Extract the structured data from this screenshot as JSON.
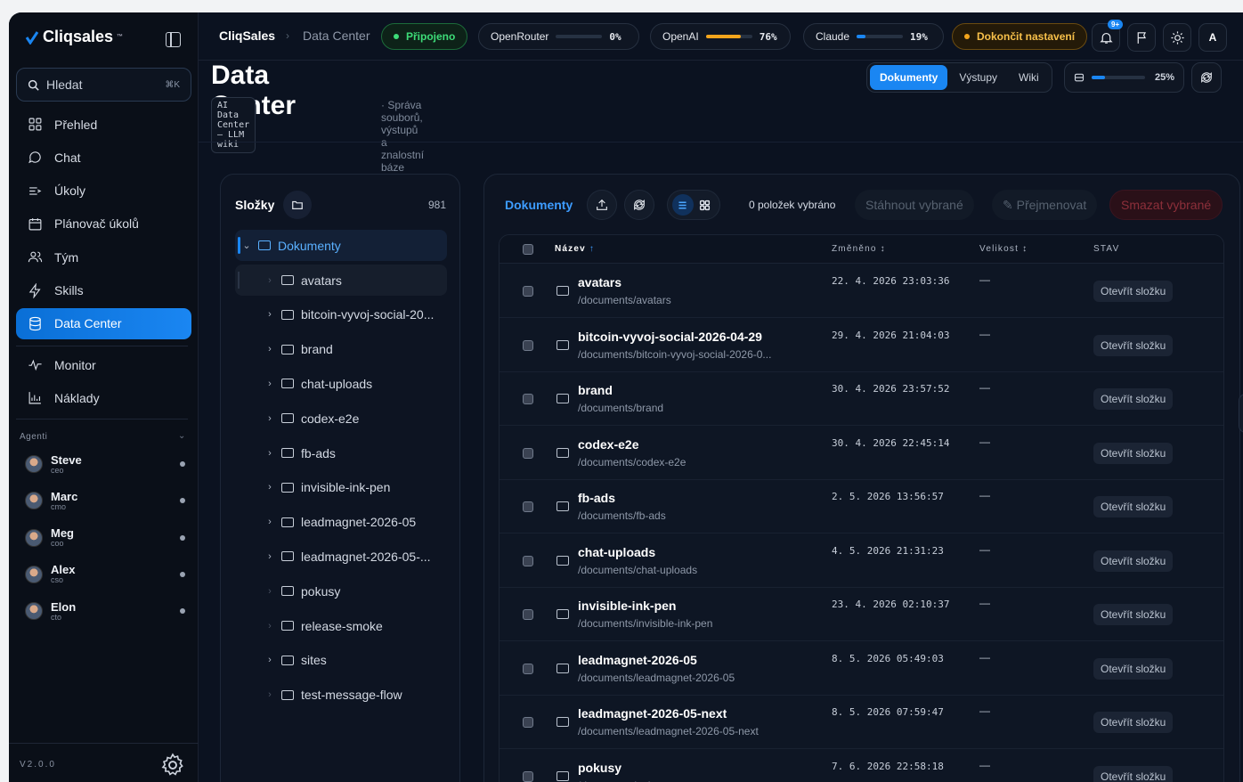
{
  "sidebar": {
    "logo": "Cliqsales",
    "logo_tm": "™",
    "search_placeholder": "Hledat",
    "search_shortcut": "⌘K",
    "nav": [
      {
        "label": "Přehled",
        "icon": "grid-icon"
      },
      {
        "label": "Chat",
        "icon": "chat-icon"
      },
      {
        "label": "Úkoly",
        "icon": "tasks-icon"
      },
      {
        "label": "Plánovač úkolů",
        "icon": "calendar-icon"
      },
      {
        "label": "Tým",
        "icon": "team-icon"
      },
      {
        "label": "Skills",
        "icon": "lightning-icon"
      },
      {
        "label": "Data Center",
        "icon": "database-icon",
        "active": true
      }
    ],
    "nav2": [
      {
        "label": "Monitor",
        "icon": "pulse-icon"
      },
      {
        "label": "Náklady",
        "icon": "chart-icon"
      }
    ],
    "agents_label": "Agenti",
    "agents": [
      {
        "name": "Steve",
        "role": "ceo"
      },
      {
        "name": "Marc",
        "role": "cmo"
      },
      {
        "name": "Meg",
        "role": "coo"
      },
      {
        "name": "Alex",
        "role": "cso"
      },
      {
        "name": "Elon",
        "role": "cto"
      }
    ],
    "version": "V2.0.0"
  },
  "topbar": {
    "app": "CliqSales",
    "section": "Data Center",
    "status": "Připojeno",
    "providers": [
      {
        "name": "OpenRouter",
        "usage": 0,
        "label": "0%"
      },
      {
        "name": "OpenAI",
        "usage": 76,
        "label": "76%"
      },
      {
        "name": "Claude",
        "usage": 19,
        "label": "19%"
      }
    ],
    "setup": "Dokončit nastavení",
    "notif_count": "9+",
    "avatar_letter": "A"
  },
  "header": {
    "title": "Data Center",
    "tag": "AI Data Center — LLM wiki",
    "subtitle": "· Správa souborů, výstupů a znalostní báze",
    "tabs": [
      "Dokumenty",
      "Výstupy",
      "Wiki"
    ],
    "active_tab": "Dokumenty",
    "storage_usage": 25,
    "storage_label": "25%"
  },
  "folders": {
    "title": "Složky",
    "count": "981",
    "root": "Dokumenty",
    "items": [
      {
        "name": "avatars",
        "has_children": false
      },
      {
        "name": "bitcoin-vyvoj-social-20...",
        "has_children": true
      },
      {
        "name": "brand",
        "has_children": true
      },
      {
        "name": "chat-uploads",
        "has_children": true
      },
      {
        "name": "codex-e2e",
        "has_children": true
      },
      {
        "name": "fb-ads",
        "has_children": true
      },
      {
        "name": "invisible-ink-pen",
        "has_children": true
      },
      {
        "name": "leadmagnet-2026-05",
        "has_children": true
      },
      {
        "name": "leadmagnet-2026-05-...",
        "has_children": true
      },
      {
        "name": "pokusy",
        "has_children": false
      },
      {
        "name": "release-smoke",
        "has_children": false
      },
      {
        "name": "sites",
        "has_children": true
      },
      {
        "name": "test-message-flow",
        "has_children": false
      }
    ]
  },
  "docs": {
    "title": "Dokumenty",
    "selected": "0 položek vybráno",
    "download": "Stáhnout vybrané",
    "rename": "✎ Přejmenovat",
    "delete": "Smazat vybrané",
    "columns": {
      "name": "Název",
      "name_sort": "↑",
      "modified": "Změněno",
      "modified_sort": "↕",
      "size": "Velikost",
      "size_sort": "↕",
      "status": "STAV"
    },
    "rows": [
      {
        "name": "avatars",
        "path": "/documents/avatars",
        "modified": "22. 4. 2026 23:03:36",
        "size": "—",
        "action": "Otevřít složku"
      },
      {
        "name": "bitcoin-vyvoj-social-2026-04-29",
        "path": "/documents/bitcoin-vyvoj-social-2026-0...",
        "modified": "29. 4. 2026 21:04:03",
        "size": "—",
        "action": "Otevřít složku"
      },
      {
        "name": "brand",
        "path": "/documents/brand",
        "modified": "30. 4. 2026 23:57:52",
        "size": "—",
        "action": "Otevřít složku"
      },
      {
        "name": "codex-e2e",
        "path": "/documents/codex-e2e",
        "modified": "30. 4. 2026 22:45:14",
        "size": "—",
        "action": "Otevřít složku"
      },
      {
        "name": "fb-ads",
        "path": "/documents/fb-ads",
        "modified": "2. 5. 2026 13:56:57",
        "size": "—",
        "action": "Otevřít složku"
      },
      {
        "name": "chat-uploads",
        "path": "/documents/chat-uploads",
        "modified": "4. 5. 2026 21:31:23",
        "size": "—",
        "action": "Otevřít složku"
      },
      {
        "name": "invisible-ink-pen",
        "path": "/documents/invisible-ink-pen",
        "modified": "23. 4. 2026 02:10:37",
        "size": "—",
        "action": "Otevřít složku"
      },
      {
        "name": "leadmagnet-2026-05",
        "path": "/documents/leadmagnet-2026-05",
        "modified": "8. 5. 2026 05:49:03",
        "size": "—",
        "action": "Otevřít složku"
      },
      {
        "name": "leadmagnet-2026-05-next",
        "path": "/documents/leadmagnet-2026-05-next",
        "modified": "8. 5. 2026 07:59:47",
        "size": "—",
        "action": "Otevřít složku"
      },
      {
        "name": "pokusy",
        "path": "/documents/pokusy",
        "modified": "7. 6. 2026 22:58:18",
        "size": "—",
        "action": "Otevřít složku"
      }
    ]
  }
}
